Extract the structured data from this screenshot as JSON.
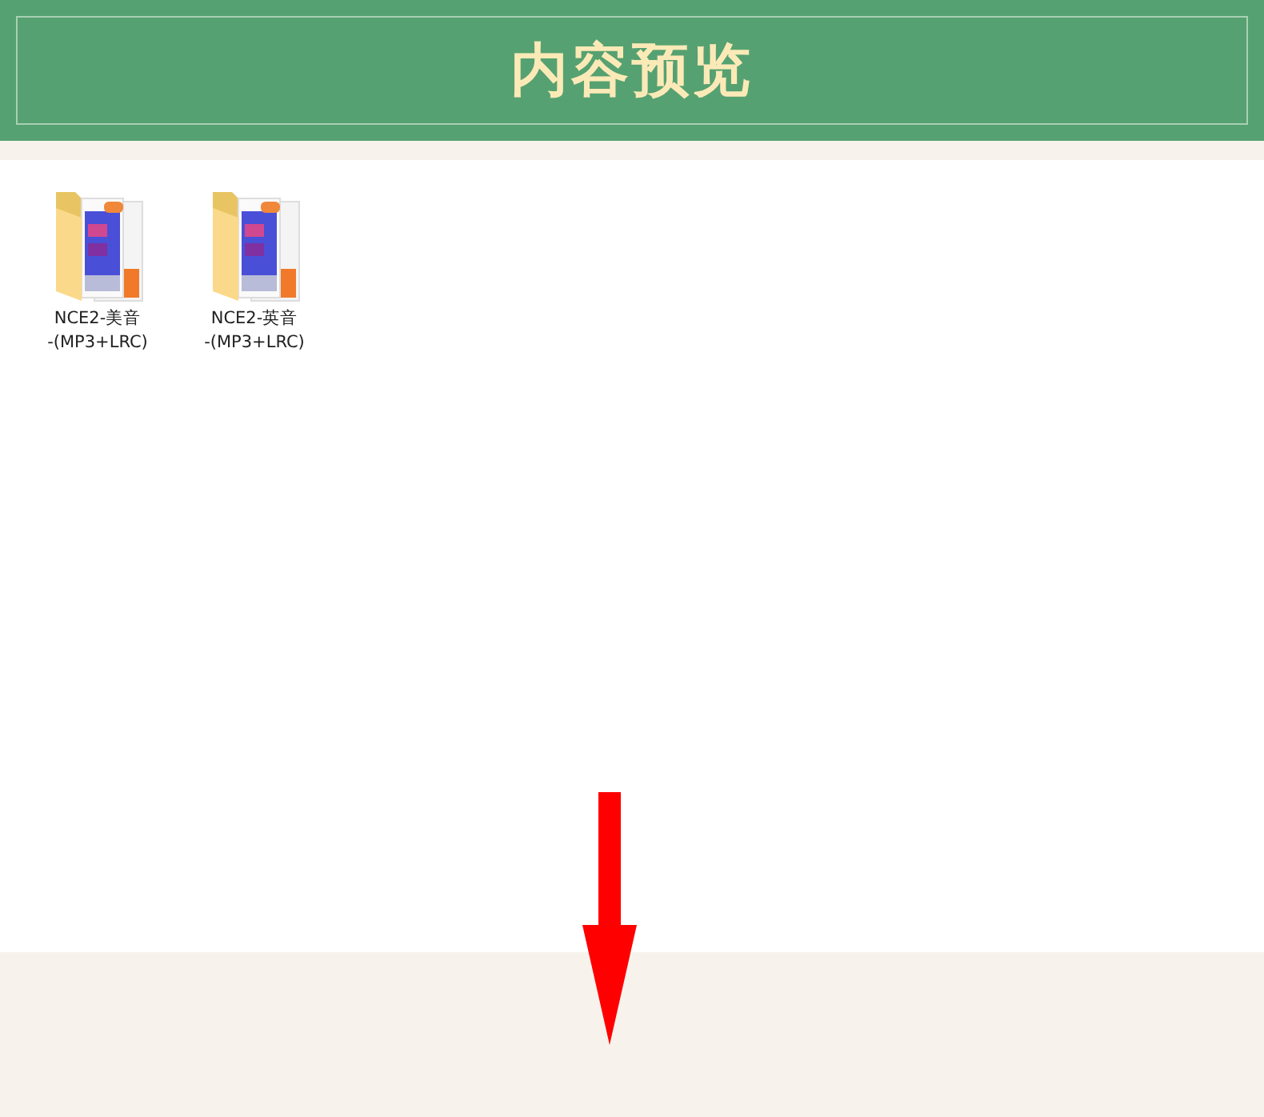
{
  "header": {
    "title": "内容预览"
  },
  "files": [
    {
      "name_line1": "NCE2-美音",
      "name_line2": "-(MP3+LRC)"
    },
    {
      "name_line1": "NCE2-英音",
      "name_line2": "-(MP3+LRC)"
    }
  ]
}
